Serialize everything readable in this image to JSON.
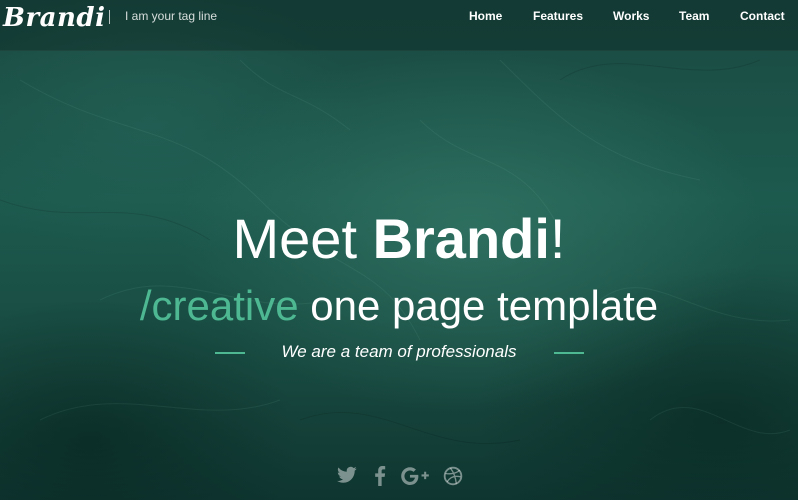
{
  "brand": {
    "logo": "Brandi",
    "tagline": "I am your tag line"
  },
  "nav": {
    "items": [
      "Home",
      "Features",
      "Works",
      "Team",
      "Contact"
    ]
  },
  "hero": {
    "headline_pre": "Meet ",
    "headline_name": "Brandi",
    "headline_post": "!",
    "sub_accent": "/creative",
    "sub_rest": " one page template",
    "team_line": "We are a team of professionals"
  },
  "social": [
    "twitter-icon",
    "facebook-icon",
    "google-plus-icon",
    "dribbble-icon"
  ],
  "colors": {
    "accent": "#4db892",
    "background": "#1d5a4e",
    "text": "#ffffff"
  }
}
